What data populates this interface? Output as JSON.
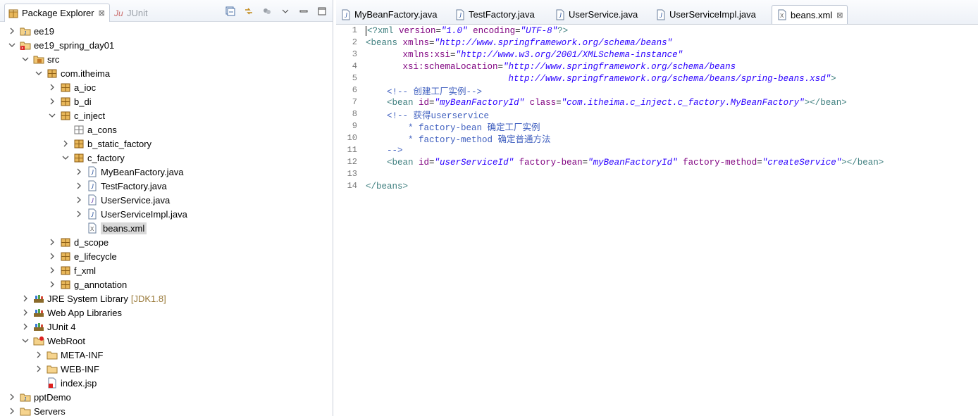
{
  "explorer": {
    "tab_label": "Package Explorer",
    "junit_tab_label": "JUnit",
    "close_glyph": "⊠",
    "tree": [
      {
        "label": "ee19",
        "depth": 0,
        "arrow": "collapsed",
        "icon": "project-icon"
      },
      {
        "label": "ee19_spring_day01",
        "depth": 0,
        "arrow": "expanded",
        "icon": "project-error-icon"
      },
      {
        "label": "src",
        "depth": 1,
        "arrow": "expanded",
        "icon": "source-folder-icon"
      },
      {
        "label": "com.itheima",
        "depth": 2,
        "arrow": "expanded",
        "icon": "package-icon"
      },
      {
        "label": "a_ioc",
        "depth": 3,
        "arrow": "collapsed",
        "icon": "package-icon"
      },
      {
        "label": "b_di",
        "depth": 3,
        "arrow": "collapsed",
        "icon": "package-icon"
      },
      {
        "label": "c_inject",
        "depth": 3,
        "arrow": "expanded",
        "icon": "package-icon"
      },
      {
        "label": "a_cons",
        "depth": 4,
        "arrow": "none",
        "icon": "empty-package-icon"
      },
      {
        "label": "b_static_factory",
        "depth": 4,
        "arrow": "collapsed",
        "icon": "package-icon"
      },
      {
        "label": "c_factory",
        "depth": 4,
        "arrow": "expanded",
        "icon": "package-icon"
      },
      {
        "label": "MyBeanFactory.java",
        "depth": 5,
        "arrow": "collapsed",
        "icon": "java-file-icon"
      },
      {
        "label": "TestFactory.java",
        "depth": 5,
        "arrow": "collapsed",
        "icon": "java-file-icon"
      },
      {
        "label": "UserService.java",
        "depth": 5,
        "arrow": "collapsed",
        "icon": "java-interface-icon"
      },
      {
        "label": "UserServiceImpl.java",
        "depth": 5,
        "arrow": "collapsed",
        "icon": "java-file-icon"
      },
      {
        "label": "beans.xml",
        "depth": 5,
        "arrow": "none",
        "icon": "xml-file-icon",
        "selected": true
      },
      {
        "label": "d_scope",
        "depth": 3,
        "arrow": "collapsed",
        "icon": "package-icon"
      },
      {
        "label": "e_lifecycle",
        "depth": 3,
        "arrow": "collapsed",
        "icon": "package-icon"
      },
      {
        "label": "f_xml",
        "depth": 3,
        "arrow": "collapsed",
        "icon": "package-icon"
      },
      {
        "label": "g_annotation",
        "depth": 3,
        "arrow": "collapsed",
        "icon": "package-icon"
      },
      {
        "label": "JRE System Library",
        "decoration": "[JDK1.8]",
        "depth": 1,
        "arrow": "collapsed",
        "icon": "library-icon"
      },
      {
        "label": "Web App Libraries",
        "depth": 1,
        "arrow": "collapsed",
        "icon": "library-icon"
      },
      {
        "label": "JUnit 4",
        "depth": 1,
        "arrow": "collapsed",
        "icon": "library-icon"
      },
      {
        "label": "WebRoot",
        "depth": 1,
        "arrow": "expanded",
        "icon": "folder-error-icon"
      },
      {
        "label": "META-INF",
        "depth": 2,
        "arrow": "collapsed",
        "icon": "folder-icon"
      },
      {
        "label": "WEB-INF",
        "depth": 2,
        "arrow": "collapsed",
        "icon": "folder-icon"
      },
      {
        "label": "index.jsp",
        "depth": 2,
        "arrow": "none",
        "icon": "jsp-file-icon"
      },
      {
        "label": "pptDemo",
        "depth": 0,
        "arrow": "collapsed",
        "icon": "project-icon"
      },
      {
        "label": "Servers",
        "depth": 0,
        "arrow": "collapsed",
        "icon": "folder-icon"
      }
    ]
  },
  "editor": {
    "tabs": [
      {
        "label": "MyBeanFactory.java",
        "icon": "java-file-icon"
      },
      {
        "label": "TestFactory.java",
        "icon": "java-file-icon"
      },
      {
        "label": "UserService.java",
        "icon": "java-file-icon"
      },
      {
        "label": "UserServiceImpl.java",
        "icon": "java-file-icon"
      },
      {
        "label": "beans.xml",
        "icon": "xml-file-icon",
        "active": true
      }
    ],
    "lines": [
      [
        [
          "pi",
          "<?xml "
        ],
        [
          "attr",
          "version"
        ],
        [
          "txt",
          "="
        ],
        [
          "str",
          "\"1.0\""
        ],
        [
          "txt",
          " "
        ],
        [
          "attr",
          "encoding"
        ],
        [
          "txt",
          "="
        ],
        [
          "str",
          "\"UTF-8\""
        ],
        [
          "pi",
          "?>"
        ]
      ],
      [
        [
          "tag",
          "<beans "
        ],
        [
          "attr",
          "xmlns"
        ],
        [
          "txt",
          "="
        ],
        [
          "str",
          "\"http://www.springframework.org/schema/beans\""
        ]
      ],
      [
        [
          "txt",
          "       "
        ],
        [
          "attr",
          "xmlns:xsi"
        ],
        [
          "txt",
          "="
        ],
        [
          "str",
          "\"http://www.w3.org/2001/XMLSchema-instance\""
        ]
      ],
      [
        [
          "txt",
          "       "
        ],
        [
          "attr",
          "xsi:schemaLocation"
        ],
        [
          "txt",
          "="
        ],
        [
          "str",
          "\"http://www.springframework.org/schema/beans"
        ]
      ],
      [
        [
          "str",
          "                           http://www.springframework.org/schema/beans/spring-beans.xsd\""
        ],
        [
          "tag",
          ">"
        ]
      ],
      [
        [
          "com",
          "    <!-- "
        ],
        [
          "cjk",
          "创建工厂实例"
        ],
        [
          "com",
          "-->"
        ]
      ],
      [
        [
          "tag",
          "    <bean "
        ],
        [
          "attr",
          "id"
        ],
        [
          "txt",
          "="
        ],
        [
          "str",
          "\"myBeanFactoryId\""
        ],
        [
          "txt",
          " "
        ],
        [
          "attr",
          "class"
        ],
        [
          "txt",
          "="
        ],
        [
          "str",
          "\"com.itheima.c_inject.c_factory.MyBeanFactory\""
        ],
        [
          "tag",
          "></bean>"
        ]
      ],
      [
        [
          "com",
          "    <!-- "
        ],
        [
          "cjk",
          "获得"
        ],
        [
          "com",
          "userservice"
        ]
      ],
      [
        [
          "com",
          "        * factory-bean "
        ],
        [
          "cjk",
          "确定工厂实例"
        ]
      ],
      [
        [
          "com",
          "        * factory-method "
        ],
        [
          "cjk",
          "确定普通方法"
        ]
      ],
      [
        [
          "com",
          "    -->"
        ]
      ],
      [
        [
          "tag",
          "    <bean "
        ],
        [
          "attr",
          "id"
        ],
        [
          "txt",
          "="
        ],
        [
          "str",
          "\"userServiceId\""
        ],
        [
          "txt",
          " "
        ],
        [
          "attr",
          "factory-bean"
        ],
        [
          "txt",
          "="
        ],
        [
          "str",
          "\"myBeanFactoryId\""
        ],
        [
          "txt",
          " "
        ],
        [
          "attr",
          "factory-method"
        ],
        [
          "txt",
          "="
        ],
        [
          "str",
          "\"createService\""
        ],
        [
          "tag",
          "></bean>"
        ]
      ],
      [],
      [
        [
          "tag",
          "</beans>"
        ]
      ]
    ]
  },
  "colors": {
    "xml_tag": "#3f7f7f",
    "xml_attr": "#7f007f",
    "xml_string": "#2a00ff",
    "xml_comment": "#3f5fbf",
    "line_number": "#787878"
  }
}
